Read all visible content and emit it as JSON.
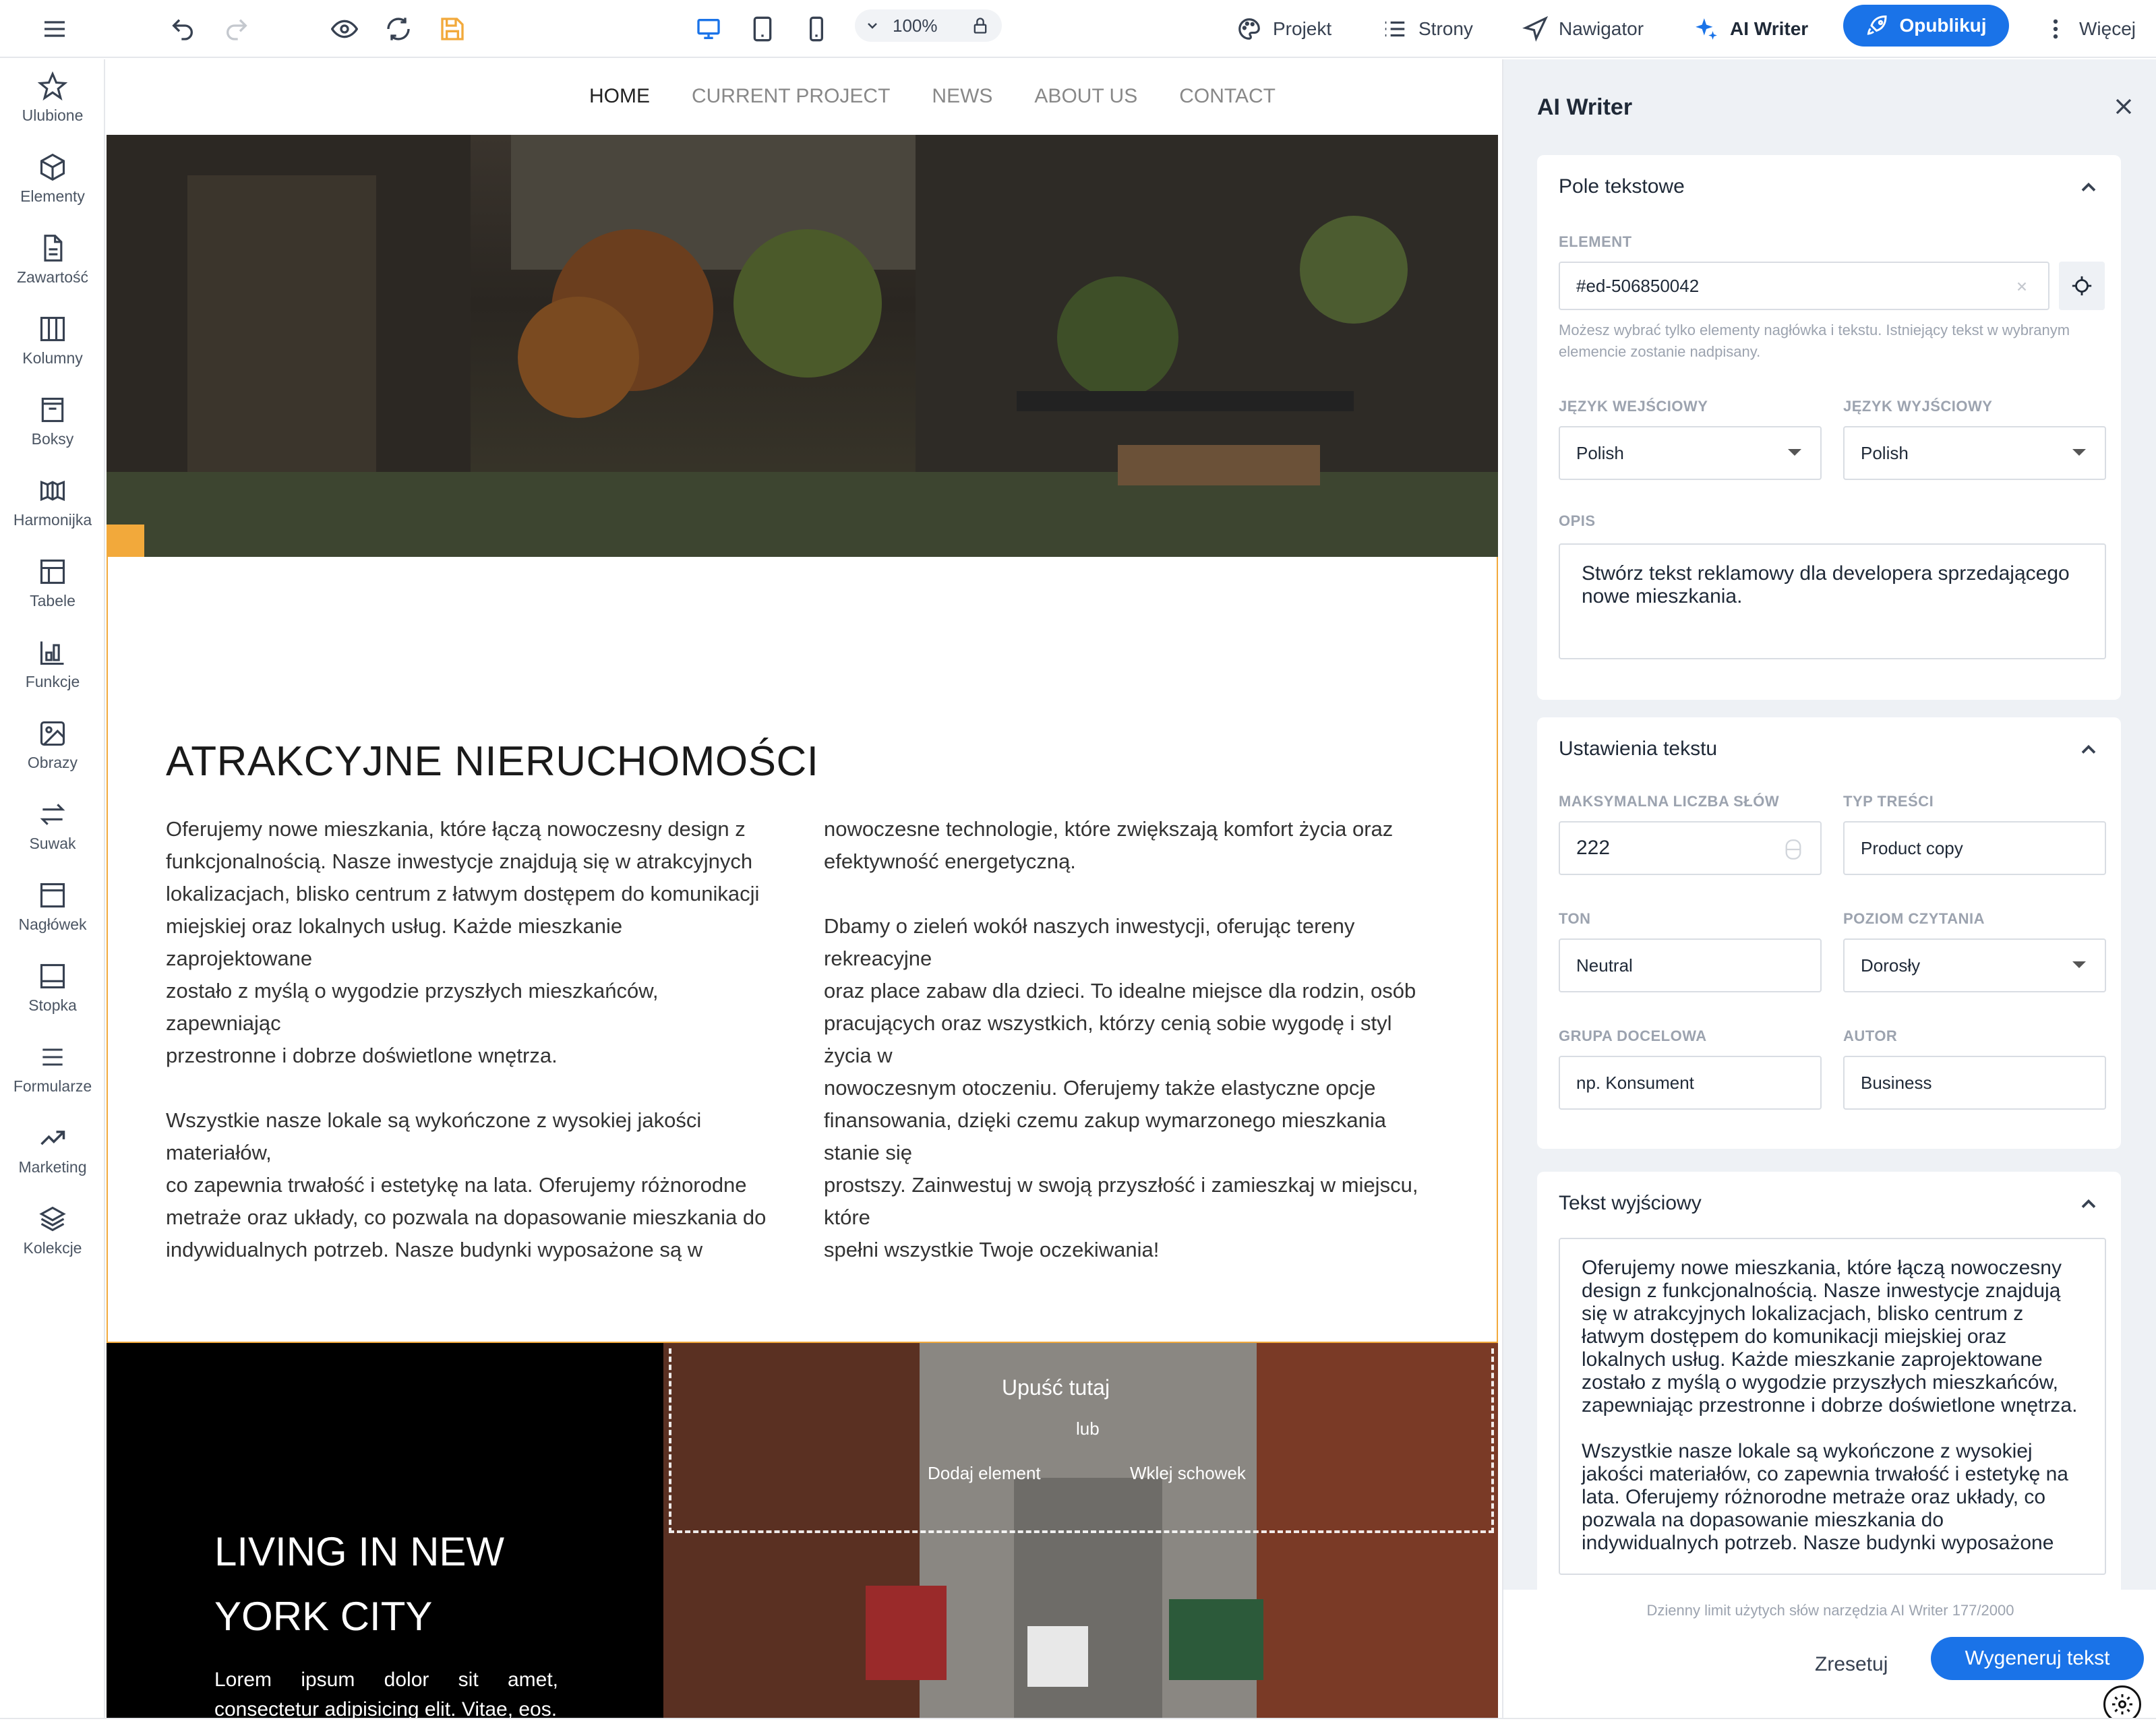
{
  "toolbar": {
    "zoom": "100%",
    "projekt": "Projekt",
    "strony": "Strony",
    "nawigator": "Nawigator",
    "ai_writer": "AI Writer",
    "publish": "Opublikuj",
    "more": "Więcej"
  },
  "sidebar": {
    "items": [
      {
        "label": "Ulubione",
        "icon": "star-icon"
      },
      {
        "label": "Elementy",
        "icon": "cube-icon"
      },
      {
        "label": "Zawartość",
        "icon": "document-icon"
      },
      {
        "label": "Kolumny",
        "icon": "columns-icon"
      },
      {
        "label": "Boksy",
        "icon": "box-icon"
      },
      {
        "label": "Harmonijka",
        "icon": "accordion-icon"
      },
      {
        "label": "Tabele",
        "icon": "table-icon"
      },
      {
        "label": "Funkcje",
        "icon": "features-icon"
      },
      {
        "label": "Obrazy",
        "icon": "image-icon"
      },
      {
        "label": "Suwak",
        "icon": "slider-icon"
      },
      {
        "label": "Nagłówek",
        "icon": "header-icon"
      },
      {
        "label": "Stopka",
        "icon": "footer-icon"
      },
      {
        "label": "Formularze",
        "icon": "form-icon"
      },
      {
        "label": "Marketing",
        "icon": "trend-icon"
      },
      {
        "label": "Kolekcje",
        "icon": "layers-icon"
      }
    ]
  },
  "site": {
    "nav": [
      "HOME",
      "CURRENT PROJECT",
      "NEWS",
      "ABOUT US",
      "CONTACT"
    ],
    "heading": "ATRAKCYJNE NIERUCHOMOŚCI",
    "col1": "Oferujemy nowe mieszkania, które łączą nowoczesny design z\nfunkcjonalnością. Nasze inwestycje znajdują się w atrakcyjnych\nlokalizacjach, blisko centrum z łatwym dostępem do komunikacji\nmiejskiej oraz lokalnych usług. Każde mieszkanie zaprojektowane\nzostało z myślą o wygodzie przyszłych mieszkańców, zapewniając\nprzestronne i dobrze doświetlone wnętrza.\n\nWszystkie nasze lokale są wykończone z wysokiej jakości materiałów,\nco zapewnia trwałość i estetykę na lata. Oferujemy różnorodne\nmetraże oraz układy, co pozwala na dopasowanie mieszkania do\nindywidualnych potrzeb. Nasze budynki wyposażone są w",
    "col2": "nowoczesne technologie, które zwiększają komfort życia oraz\nefektywność energetyczną.\n\nDbamy o zieleń wokół naszych inwestycji, oferując tereny rekreacyjne\noraz place zabaw dla dzieci. To idealne miejsce dla rodzin, osób\npracujących oraz wszystkich, którzy cenią sobie wygodę i styl życia w\nnowoczesnym otoczeniu. Oferujemy także elastyczne opcje\nfinansowania, dzięki czemu zakup wymarzonego mieszkania stanie się\nprostszy. Zainwestuj w swoją przyszłość i zamieszkaj w miejscu, które\nspełni wszystkie Twoje oczekiwania!",
    "living_title": "LIVING IN NEW\nYORK CITY",
    "living_text": "Lorem ipsum dolor sit amet, consectetur adipisicing elit. Vitae, eos.",
    "drop_here": "Upuść tutaj",
    "drop_or": "lub",
    "drop_add": "Dodaj element",
    "drop_paste": "Wklej schowek"
  },
  "panel": {
    "title": "AI Writer",
    "field_card": {
      "title": "Pole tekstowe",
      "element_label": "ELEMENT",
      "element_value": "#ed-506850042",
      "hint": "Możesz wybrać tylko elementy nagłówka i tekstu. Istniejący tekst w wybranym elemencie zostanie nadpisany.",
      "in_lang_label": "JĘZYK WEJŚCIOWY",
      "in_lang": "Polish",
      "out_lang_label": "JĘZYK WYJŚCIOWY",
      "out_lang": "Polish",
      "desc_label": "OPIS",
      "desc": "Stwórz tekst reklamowy dla developera sprzedającego nowe mieszkania."
    },
    "settings_card": {
      "title": "Ustawienia tekstu",
      "max_words_label": "MAKSYMALNA LICZBA SŁÓW",
      "max_words": "222",
      "content_type_label": "TYP TREŚCI",
      "content_type": "Product copy",
      "tone_label": "TON",
      "tone": "Neutral",
      "reading_label": "POZIOM CZYTANIA",
      "reading": "Dorosły",
      "audience_label": "GRUPA DOCELOWA",
      "audience_placeholder": "np. Konsument",
      "author_label": "AUTOR",
      "author": "Business"
    },
    "output_card": {
      "title": "Tekst wyjściowy",
      "text": "Oferujemy nowe mieszkania, które łączą nowoczesny design z funkcjonalnością. Nasze inwestycje znajdują się w atrakcyjnych lokalizacjach, blisko centrum z łatwym dostępem do komunikacji miejskiej oraz lokalnych usług. Każde mieszkanie zaprojektowane zostało z myślą o wygodzie przyszłych mieszkańców, zapewniając przestronne i dobrze doświetlone wnętrza.\n\nWszystkie nasze lokale są wykończone z wysokiej jakości materiałów, co zapewnia trwałość i estetykę na lata. Oferujemy różnorodne metraże oraz układy, co pozwala na dopasowanie mieszkania do indywidualnych potrzeb. Nasze budynki wyposażone"
    },
    "limit": "Dzienny limit użytych słów narzędzia AI Writer 177/2000",
    "reset": "Zresetuj",
    "generate": "Wygeneruj tekst"
  },
  "colors": {
    "accent": "#1a73e8",
    "section_border": "#f2a93b",
    "save_icon": "#f2a93b"
  }
}
